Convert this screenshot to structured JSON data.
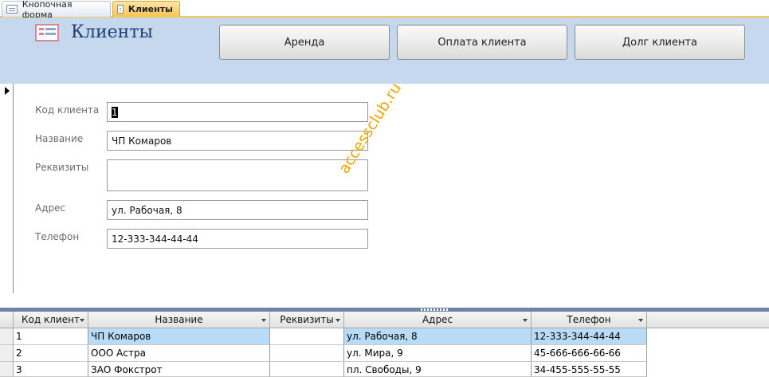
{
  "tabs": [
    {
      "label": "Кнопочная форма",
      "active": false
    },
    {
      "label": "Клиенты",
      "active": true
    }
  ],
  "header": {
    "title": "Клиенты",
    "buttons": [
      "Аренда",
      "Оплата клиента",
      "Долг клиента"
    ]
  },
  "form": {
    "fields": [
      {
        "label": "Код клиента",
        "value": "1"
      },
      {
        "label": "Название",
        "value": "ЧП Комаров"
      },
      {
        "label": "Реквизиты",
        "value": ""
      },
      {
        "label": "Адрес",
        "value": "ул. Рабочая, 8"
      },
      {
        "label": "Телефон",
        "value": "12-333-344-44-44"
      }
    ]
  },
  "watermark": "accessclub.ru",
  "datasheet": {
    "columns": [
      "Код клиент",
      "Название",
      "Реквизиты",
      "Адрес",
      "Телефон"
    ],
    "rows": [
      [
        "1",
        "ЧП Комаров",
        "",
        "ул. Рабочая, 8",
        "12-333-344-44-44"
      ],
      [
        "2",
        "ООО Астра",
        "",
        "ул. Мира, 9",
        "45-666-666-66-66"
      ],
      [
        "3",
        "ЗАО Фокстрот",
        "",
        "пл. Свободы, 9",
        "34-455-555-55-55"
      ]
    ]
  },
  "colors": {
    "header_bg": "#c6d8ee",
    "active_tab": "#f6c453",
    "title_text": "#1f3f77",
    "current_row": "#b8dcf7",
    "watermark": "#f0a500"
  }
}
